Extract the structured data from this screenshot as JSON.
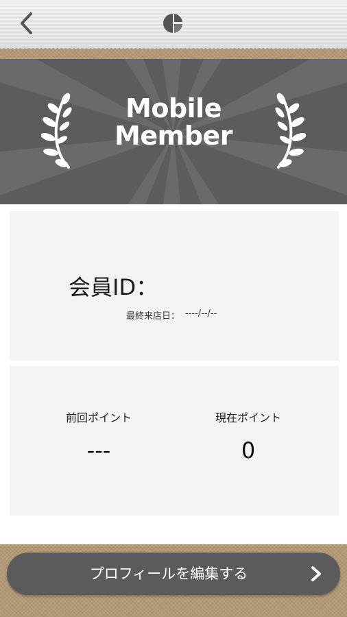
{
  "navbar": {
    "back_icon": "chevron-left-icon",
    "logo_icon": "pie-logo-icon"
  },
  "banner": {
    "title_line1": "Mobile",
    "title_line2": "Member",
    "ornament_icon": "laurel-icon"
  },
  "member_card": {
    "id_label": "会員ID：",
    "id_value": "",
    "last_visit_label": "最終来店日：",
    "last_visit_value": "----/--/--"
  },
  "points_card": {
    "previous_label": "前回ポイント",
    "previous_value": "---",
    "current_label": "現在ポイント",
    "current_value": "0"
  },
  "profile_button": {
    "label": "プロフィールを編集する",
    "icon": "chevron-right-icon"
  },
  "colors": {
    "banner_bg": "#5a5a5a",
    "button_bg": "#5b5b5b",
    "card_bg": "#f4f4f4",
    "burlap": "#b89d78"
  }
}
